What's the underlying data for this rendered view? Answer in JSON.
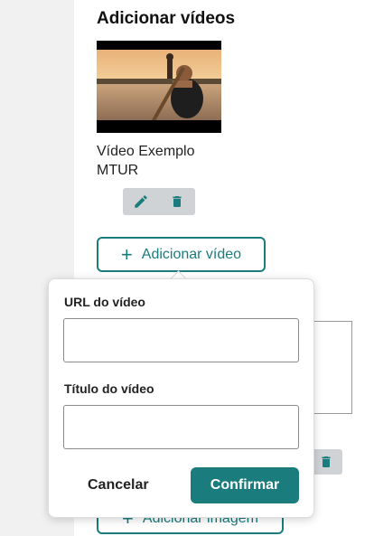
{
  "section": {
    "title": "Adicionar vídeos"
  },
  "video": {
    "title": "Vídeo Exemplo MTUR",
    "thumbnail_icon": "video-thumbnail"
  },
  "actions": {
    "edit_icon": "pencil-icon",
    "delete_icon": "trash-icon"
  },
  "add_video_button": {
    "label": "Adicionar vídeo",
    "icon": "plus-icon"
  },
  "add_image_button": {
    "label": "Adicionar imagem",
    "icon": "plus-icon"
  },
  "popover": {
    "url_label": "URL do vídeo",
    "url_value": "",
    "title_label": "Título do vídeo",
    "title_value": "",
    "cancel_label": "Cancelar",
    "confirm_label": "Confirmar"
  },
  "colors": {
    "accent": "#1a7c7c",
    "action_bg": "#cfd3d6",
    "gutter": "#f1f1f1"
  }
}
